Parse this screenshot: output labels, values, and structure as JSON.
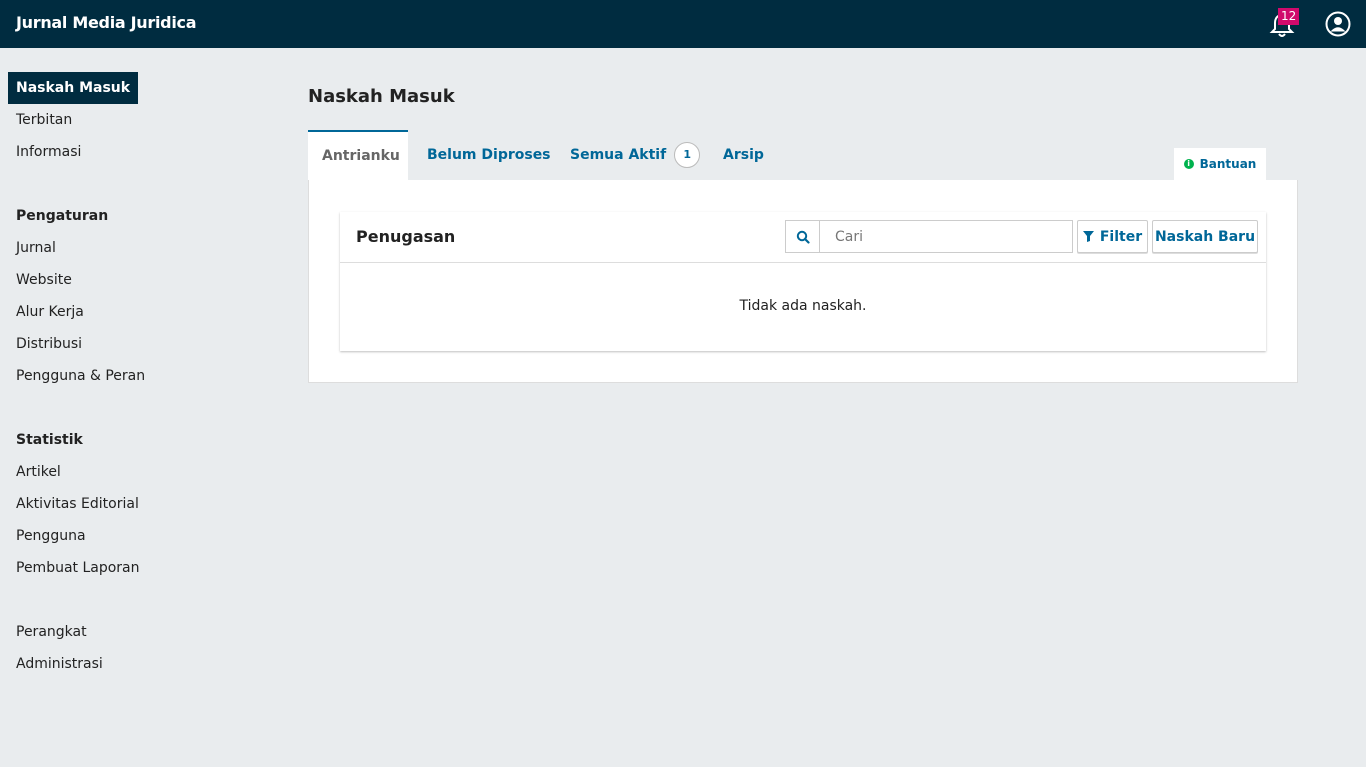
{
  "header": {
    "site_title": "Jurnal Media Juridica",
    "notification_count": "12",
    "icons": {
      "notifications": "bell-icon",
      "user": "user-circle-icon"
    },
    "colors": {
      "bar": "#002c40",
      "badge": "#d00a6c"
    }
  },
  "sidebar": {
    "items": [
      {
        "label": "Naskah Masuk",
        "active": true
      },
      {
        "label": "Terbitan"
      },
      {
        "label": "Informasi"
      }
    ],
    "settings": {
      "heading": "Pengaturan",
      "items": [
        "Jurnal",
        "Website",
        "Alur Kerja",
        "Distribusi",
        "Pengguna & Peran"
      ]
    },
    "statistics": {
      "heading": "Statistik",
      "items": [
        "Artikel",
        "Aktivitas Editorial",
        "Pengguna",
        "Pembuat Laporan"
      ]
    },
    "tools": [
      "Perangkat",
      "Administrasi"
    ]
  },
  "main": {
    "page_title": "Naskah Masuk",
    "tabs": [
      {
        "label": "Antrianku",
        "active": true
      },
      {
        "label": "Belum Diproses"
      },
      {
        "label": "Semua Aktif",
        "badge": "1"
      },
      {
        "label": "Arsip"
      }
    ],
    "help_label": "Bantuan",
    "card": {
      "title": "Penugasan",
      "search_placeholder": "Cari",
      "filter_label": "Filter",
      "new_label": "Naskah Baru",
      "empty_message": "Tidak ada naskah."
    },
    "colors": {
      "accent": "#006798",
      "help_dot": "#00b24e"
    }
  }
}
